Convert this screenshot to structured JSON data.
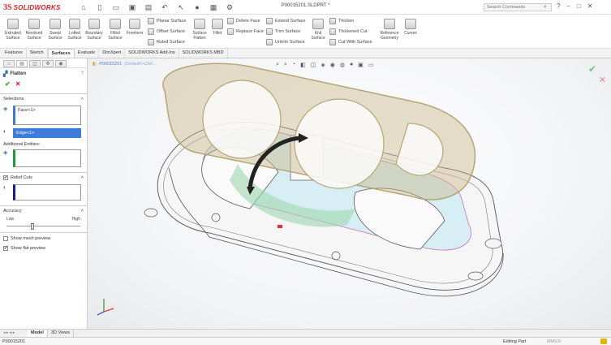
{
  "app": {
    "logo_mark": "3S",
    "logo_text": "SOLIDWORKS",
    "doc_title": "P00015201.SLDPRT *"
  },
  "search": {
    "placeholder": "Search Commands"
  },
  "window_buttons": {
    "help": "?",
    "minimize": "–",
    "restore": "□",
    "close": "✕"
  },
  "ribbon": {
    "big": [
      {
        "label1": "Extruded",
        "label2": "Surface",
        "icon": "extruded-surface-icon"
      },
      {
        "label1": "Revolved",
        "label2": "Surface",
        "icon": "revolved-surface-icon"
      },
      {
        "label1": "Swept",
        "label2": "Surface",
        "icon": "swept-surface-icon"
      },
      {
        "label1": "Lofted",
        "label2": "Surface",
        "icon": "lofted-surface-icon"
      },
      {
        "label1": "Boundary",
        "label2": "Surface",
        "icon": "boundary-surface-icon"
      },
      {
        "label1": "Filled",
        "label2": "Surface",
        "icon": "filled-surface-icon"
      },
      {
        "label1": "Freeform",
        "label2": "",
        "icon": "freeform-icon"
      }
    ],
    "group1": [
      "Planar Surface",
      "Offset Surface",
      "Ruled Surface"
    ],
    "flatten": {
      "label1": "Surface",
      "label2": "Flatten"
    },
    "fillet": {
      "label1": "Fillet",
      "label2": ""
    },
    "group2": [
      "Delete Face",
      "Replace Face"
    ],
    "group3": [
      "Extend Surface",
      "Trim Surface",
      "Untrim Surface"
    ],
    "knit": {
      "label1": "Knit",
      "label2": "Surface"
    },
    "group4": [
      "Thicken",
      "Thickened Cut",
      "Cut With Surface"
    ],
    "reference": {
      "label1": "Reference",
      "label2": "Geometry"
    },
    "curves": {
      "label1": "Curves",
      "label2": ""
    }
  },
  "command_tabs": [
    "Features",
    "Sketch",
    "Surfaces",
    "Evaluate",
    "DimXpert",
    "SOLIDWORKS Add-Ins",
    "SOLIDWORKS MBD"
  ],
  "active_command_tab": "Surfaces",
  "property_manager": {
    "title": "Flatten",
    "help": "?",
    "ok": "✔",
    "cancel": "✕",
    "selections": {
      "heading": "Selections",
      "face": "Face<1>",
      "edge": "Edge<1>"
    },
    "additional_entities": {
      "heading": "Additional Entities:"
    },
    "relief_cuts": {
      "heading": "Relief Cuts",
      "checked": true,
      "check": "✔"
    },
    "accuracy": {
      "heading": "Accuracy",
      "low": "Low",
      "high": "High",
      "level": 0.35
    },
    "show_mesh_preview": {
      "label": "Show mesh preview",
      "checked": false
    },
    "show_flat_preview": {
      "label": "Show flat preview",
      "checked": true,
      "check": "✔"
    }
  },
  "viewport": {
    "breadcrumb_part": "P00015201",
    "breadcrumb_config": "(Default<<Def..."
  },
  "bottom_tabs": {
    "nav": "◂ ▸ ◂ ▸",
    "tabs": [
      "Model",
      "3D Views"
    ],
    "active": "Model"
  },
  "status": {
    "part": "P00015201",
    "mode": "Editing Part",
    "units": "MMGS"
  },
  "colors": {
    "brand": "#dd2222",
    "accent": "#3b7dd8",
    "highlight_surface": "#7fd4e8",
    "flatten_preview": "#c9b98a"
  }
}
